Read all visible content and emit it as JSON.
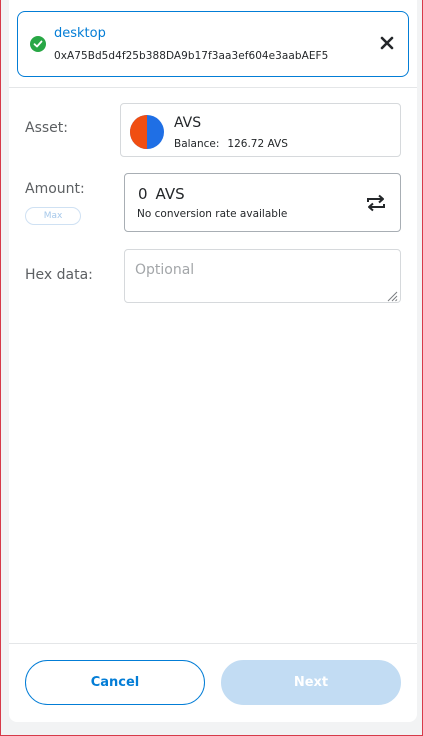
{
  "recipient": {
    "name": "desktop",
    "address": "0xA75Bd5d4f25b388DA9b17f3aa3ef604e3aabAEF5"
  },
  "asset": {
    "label": "Asset:",
    "name": "AVS",
    "balance_label": "Balance:",
    "balance_value": "126.72 AVS"
  },
  "amount": {
    "label": "Amount:",
    "max_label": "Max",
    "value": "0",
    "unit": "AVS",
    "conversion_text": "No conversion rate available"
  },
  "hex": {
    "label": "Hex data:",
    "placeholder": "Optional"
  },
  "footer": {
    "cancel_label": "Cancel",
    "next_label": "Next"
  },
  "colors": {
    "accent": "#037dd6",
    "success": "#28a745",
    "disabled_button": "#c2dcf3",
    "asset_orange": "#f04e12",
    "asset_blue": "#1f6fe5"
  },
  "icons": [
    "check-circle-icon",
    "close-icon",
    "swap-icon",
    "resize-grip-icon",
    "asset-token-icon"
  ]
}
